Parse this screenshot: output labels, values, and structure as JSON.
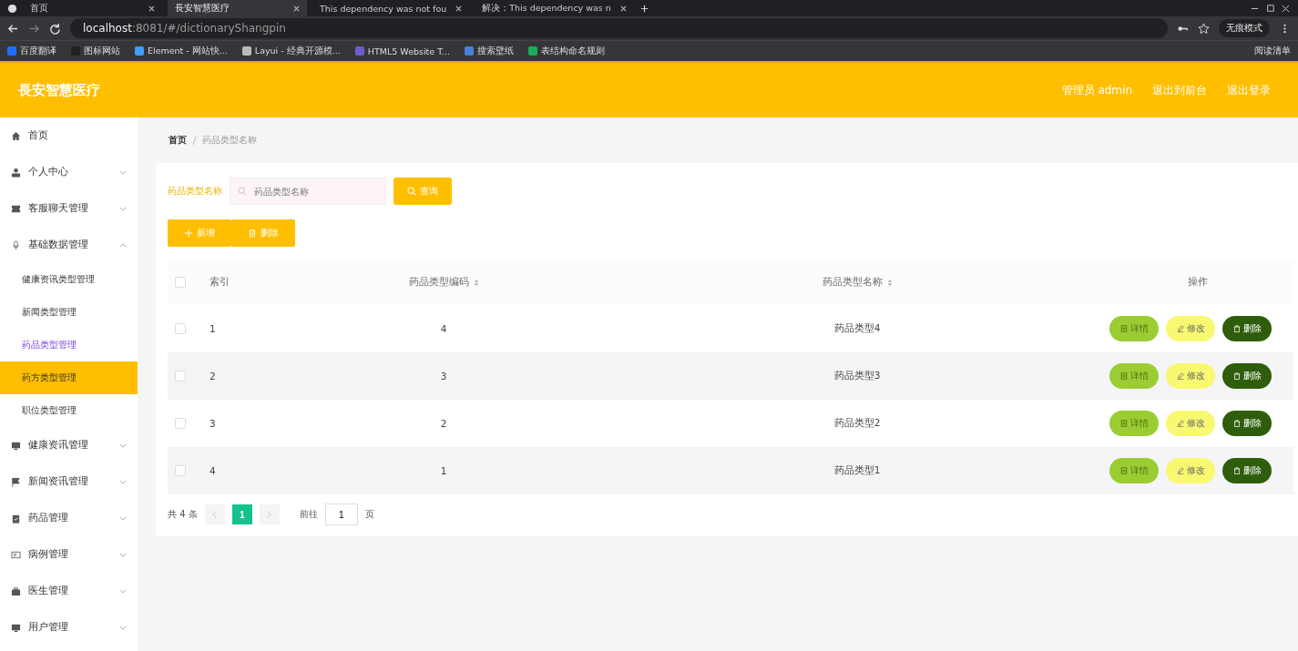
{
  "browser": {
    "tabs": [
      {
        "title": "首页",
        "selected": false
      },
      {
        "title": "長安智慧医疗",
        "selected": true
      },
      {
        "title": "This dependency was not fou",
        "selected": false
      },
      {
        "title": "解决：This dependency was n",
        "selected": false
      }
    ],
    "url_host": "localhost",
    "url_rest": ":8081/#/dictionaryShangpin",
    "profile": "无痕模式",
    "bookmarks": [
      {
        "label": "百度翻译",
        "color": "#1e6fff"
      },
      {
        "label": "图标网站",
        "color": "#222222"
      },
      {
        "label": "Element - 网站快...",
        "color": "#409eff"
      },
      {
        "label": "Layui - 经典开源模...",
        "color": "#bbbbbb"
      },
      {
        "label": "HTML5 Website T...",
        "color": "#6d5bd0"
      },
      {
        "label": "搜索壁纸",
        "color": "#4a7fd8"
      },
      {
        "label": "表结构命名规则",
        "color": "#1aad5a"
      }
    ],
    "reading_list": "阅读清单"
  },
  "header": {
    "title": "長安智慧医疗",
    "links": [
      "管理员 admin",
      "退出到前台",
      "退出登录"
    ]
  },
  "sidebar": {
    "items": [
      {
        "label": "首页",
        "expandable": false
      },
      {
        "label": "个人中心",
        "expandable": true,
        "expanded": false
      },
      {
        "label": "客服聊天管理",
        "expandable": true,
        "expanded": false
      },
      {
        "label": "基础数据管理",
        "expandable": true,
        "expanded": true,
        "children": [
          {
            "label": "健康资讯类型管理",
            "selected": false,
            "hovered": false
          },
          {
            "label": "新闻类型管理",
            "selected": false,
            "hovered": false
          },
          {
            "label": "药品类型管理",
            "selected": true,
            "hovered": false
          },
          {
            "label": "药方类型管理",
            "selected": false,
            "hovered": true
          },
          {
            "label": "职位类型管理",
            "selected": false,
            "hovered": false
          }
        ]
      },
      {
        "label": "健康资讯管理",
        "expandable": true,
        "expanded": false
      },
      {
        "label": "新闻资讯管理",
        "expandable": true,
        "expanded": false
      },
      {
        "label": "药品管理",
        "expandable": true,
        "expanded": false
      },
      {
        "label": "病例管理",
        "expandable": true,
        "expanded": false
      },
      {
        "label": "医生管理",
        "expandable": true,
        "expanded": false
      },
      {
        "label": "用户管理",
        "expandable": true,
        "expanded": false
      }
    ]
  },
  "breadcrumb": [
    "首页",
    "药品类型名称"
  ],
  "search": {
    "label": "药品类型名称",
    "placeholder": "药品类型名称",
    "button": "查询"
  },
  "actions": [
    "新增",
    "删除"
  ],
  "table": {
    "columns": [
      {
        "label": "索引",
        "sortable": false
      },
      {
        "label": "药品类型编码",
        "sortable": true
      },
      {
        "label": "药品类型名称",
        "sortable": true
      },
      {
        "label": "操作",
        "sortable": false
      }
    ],
    "header_checked": false,
    "rows": [
      {
        "index": "1",
        "code": "4",
        "name": "药品类型4",
        "checked": false,
        "buttons": [
          {
            "label": "详情",
            "kind": "detail"
          },
          {
            "label": "修改",
            "kind": "edit"
          },
          {
            "label": "删除",
            "kind": "delete"
          }
        ]
      },
      {
        "index": "2",
        "code": "3",
        "name": "药品类型3",
        "checked": false,
        "buttons": [
          {
            "label": "详情",
            "kind": "detail"
          },
          {
            "label": "修改",
            "kind": "edit"
          },
          {
            "label": "删除",
            "kind": "delete"
          }
        ]
      },
      {
        "index": "3",
        "code": "2",
        "name": "药品类型2",
        "checked": false,
        "buttons": [
          {
            "label": "详情",
            "kind": "detail"
          },
          {
            "label": "修改",
            "kind": "edit"
          },
          {
            "label": "删除",
            "kind": "delete"
          }
        ]
      },
      {
        "index": "4",
        "code": "1",
        "name": "药品类型1",
        "checked": false,
        "buttons": [
          {
            "label": "详情",
            "kind": "detail"
          },
          {
            "label": "修改",
            "kind": "edit"
          },
          {
            "label": "删除",
            "kind": "delete"
          }
        ]
      }
    ]
  },
  "pagination": {
    "total": "共 4 条",
    "pages": [
      {
        "label": "1",
        "selected": true
      }
    ],
    "goto_label": "前往",
    "goto_value": "1",
    "page_unit": "页"
  }
}
